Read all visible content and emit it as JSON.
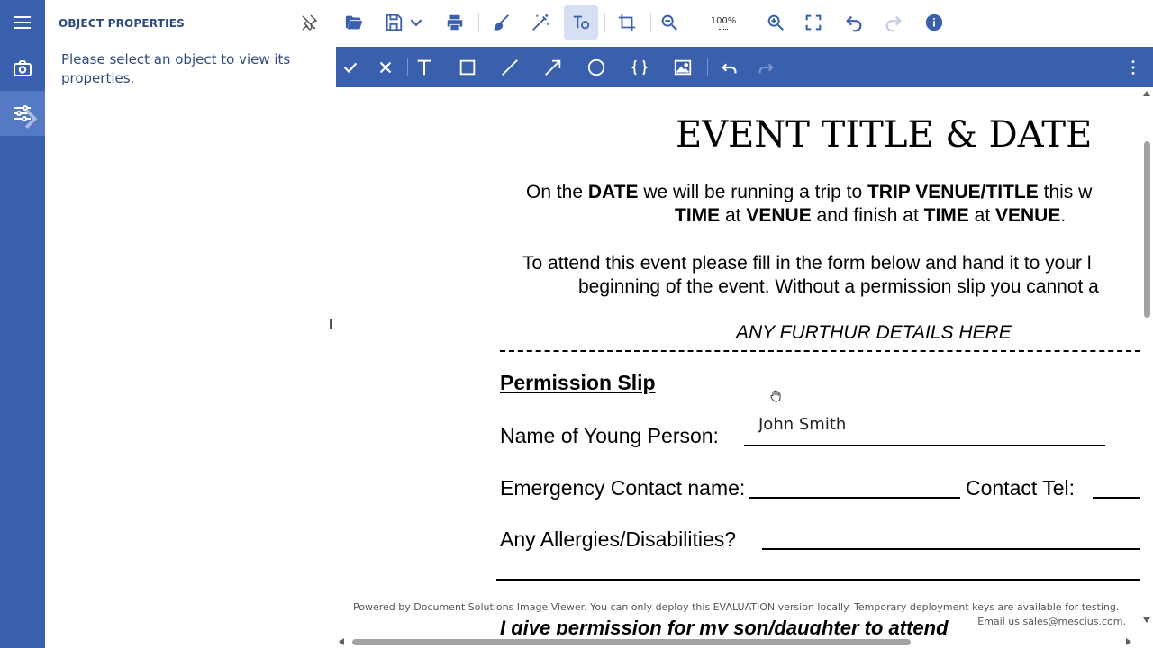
{
  "rail": {
    "items": [
      {
        "icon": "menu-icon"
      },
      {
        "icon": "camera-icon"
      },
      {
        "icon": "sliders-icon"
      }
    ]
  },
  "panel": {
    "title": "OBJECT PROPERTIES",
    "message": "Please select an object to view its properties."
  },
  "toolbar": {
    "zoom_level": "100%"
  },
  "document": {
    "title": "EVENT TITLE & DATE",
    "para1_line1": {
      "p1": "On the ",
      "b1": "DATE",
      "p2": " we will be running a trip to ",
      "b2": "TRIP VENUE/TITLE",
      "p3": " this w"
    },
    "para1_line2": {
      "b1": "TIME",
      "p1": " at ",
      "b2": "VENUE",
      "p2": " and finish at ",
      "b3": "TIME",
      "p3": " at ",
      "b4": "VENUE",
      "p4": "."
    },
    "para2_line1": "To attend this event please fill in the form below and hand it to your l",
    "para2_line2": "beginning of the event. Without a permission slip you cannot a",
    "details": "ANY FURTHUR DETAILS HERE",
    "heading": "Permission Slip",
    "name_label": "Name of Young Person:",
    "name_value": "John Smith",
    "emergency_label": "Emergency Contact name:",
    "contact_tel_label": "Contact Tel:",
    "allergies_label": "Any Allergies/Disabilities?",
    "permission_text": "I give permission for my son/daughter to attend",
    "watermark_line1": "Powered by Document Solutions Image Viewer. You can only deploy this EVALUATION version locally. Temporary deployment keys are available for testing.",
    "watermark_line2": "Email us sales@mescius.com."
  }
}
